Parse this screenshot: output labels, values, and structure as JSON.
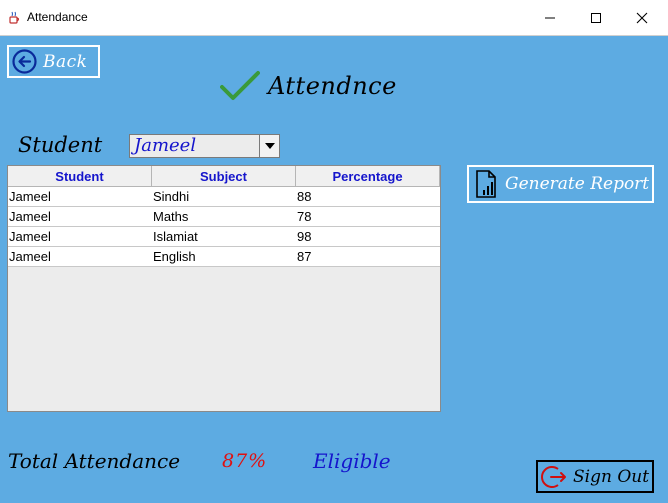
{
  "window": {
    "title": "Attendance",
    "icons": {
      "app": "java-cup-icon",
      "minimize": "minimize-icon",
      "maximize": "maximize-icon",
      "close": "close-icon"
    }
  },
  "back_button": {
    "label": "Back",
    "icon": "arrow-left-circle-icon"
  },
  "heading": {
    "label": "Attendnce",
    "icon": "checkmark-icon"
  },
  "student": {
    "label": "Student",
    "selected": "Jameel",
    "icon": "chevron-down-icon"
  },
  "table": {
    "columns": [
      "Student",
      "Subject",
      "Percentage"
    ],
    "rows": [
      [
        "Jameel",
        "Sindhi",
        "88"
      ],
      [
        "Jameel",
        "Maths",
        "78"
      ],
      [
        "Jameel",
        "Islamiat",
        "98"
      ],
      [
        "Jameel",
        "English",
        "87"
      ]
    ]
  },
  "generate_report": {
    "label": "Generate Report",
    "icon": "document-chart-icon"
  },
  "footer": {
    "total_label": "Total Attendance",
    "total_value": "87%",
    "status": "Eligible"
  },
  "sign_out": {
    "label": "Sign Out",
    "icon": "sign-out-icon"
  },
  "colors": {
    "background": "#5dabe2",
    "accent_blue": "#1515cc",
    "total_red": "#e01010",
    "check_green": "#3a9a3a"
  }
}
